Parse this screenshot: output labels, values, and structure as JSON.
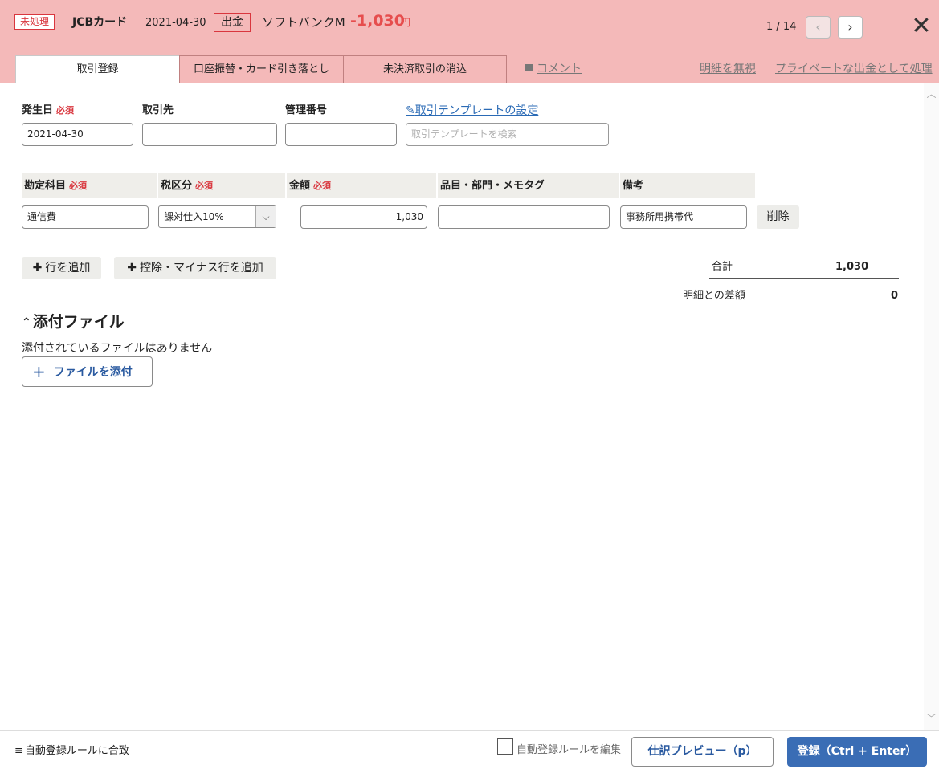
{
  "header": {
    "status": "未処理",
    "account": "JCBカード",
    "date": "2021-04-30",
    "direction": "出金",
    "partner": "ソフトバンクM",
    "amount": "-1,030",
    "amount_unit": "円",
    "pager": "1 / 14",
    "prev_icon": "‹",
    "next_icon": "›",
    "close_icon": "✕"
  },
  "tabs": [
    "取引登録",
    "口座振替・カード引き落とし",
    "未決済取引の消込"
  ],
  "links": {
    "comment": "コメント",
    "ignore": "明細を無視",
    "private": "プライベートな出金として処理"
  },
  "form": {
    "date_label": "発生日",
    "required": "必須",
    "date_value": "2021-04-30",
    "partner_label": "取引先",
    "partner_value": "",
    "mgmt_label": "管理番号",
    "mgmt_value": "",
    "template_link": "取引テンプレートの設定",
    "template_placeholder": "取引テンプレートを検索"
  },
  "line_items": {
    "headers": {
      "account": "勘定科目",
      "tax": "税区分",
      "amount": "金額",
      "tags": "品目・部門・メモタグ",
      "note": "備考"
    },
    "row": {
      "account": "通信費",
      "tax": "課対仕入10%",
      "amount": "1,030",
      "tags": "",
      "note": "事務所用携帯代",
      "delete": "削除"
    }
  },
  "actions": {
    "add_row": "行を追加",
    "add_minus_row": "控除・マイナス行を追加"
  },
  "totals": {
    "total_label": "合計",
    "total_value": "1,030",
    "diff_label": "明細との差額",
    "diff_value": "0"
  },
  "attachments": {
    "title": "添付ファイル",
    "empty": "添付されているファイルはありません",
    "button": "ファイルを添付"
  },
  "footer": {
    "rule_link": "自動登録ルール",
    "rule_suffix": "に合致",
    "edit_rule": "自動登録ルールを編集",
    "edit_rule_checked": false,
    "preview": "仕訳プレビュー（p）",
    "submit": "登録（Ctrl + Enter）"
  },
  "colors": {
    "header_bg": "#f4b9b9",
    "accent_red": "#e64d4d",
    "link_blue": "#2a6ab5",
    "submit_bg": "#3a6db5"
  }
}
